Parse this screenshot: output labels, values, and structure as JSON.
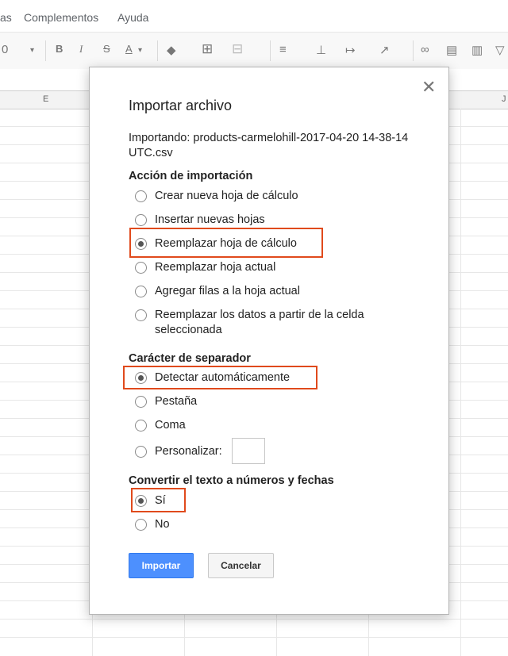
{
  "menu": {
    "items": [
      "as",
      "Complementos",
      "Ayuda"
    ]
  },
  "toolbar": {
    "zoom_fragment": "0",
    "bold": "B",
    "italic": "I",
    "strike": "S",
    "text_color": "A"
  },
  "grid": {
    "columns": [
      "E",
      "J"
    ]
  },
  "dialog": {
    "title": "Importar archivo",
    "importing_text": "Importando: products-carmelohill-2017-04-20 14-38-14 UTC.csv",
    "import_action": {
      "title": "Acción de importación",
      "options": [
        "Crear nueva hoja de cálculo",
        "Insertar nuevas hojas",
        "Reemplazar hoja de cálculo",
        "Reemplazar hoja actual",
        "Agregar filas a la hoja actual",
        "Reemplazar los datos a partir de la celda seleccionada"
      ],
      "selected": "Reemplazar hoja de cálculo"
    },
    "separator": {
      "title": "Carácter de separador",
      "options": [
        "Detectar automáticamente",
        "Pestaña",
        "Coma",
        "Personalizar:"
      ],
      "selected": "Detectar automáticamente",
      "custom_value": ""
    },
    "convert": {
      "title": "Convertir el texto a números y fechas",
      "options": [
        "Sí",
        "No"
      ],
      "selected": "Sí"
    },
    "buttons": {
      "import": "Importar",
      "cancel": "Cancelar"
    },
    "highlight_color": "#e04a1c",
    "primary_color": "#4d90fe"
  }
}
